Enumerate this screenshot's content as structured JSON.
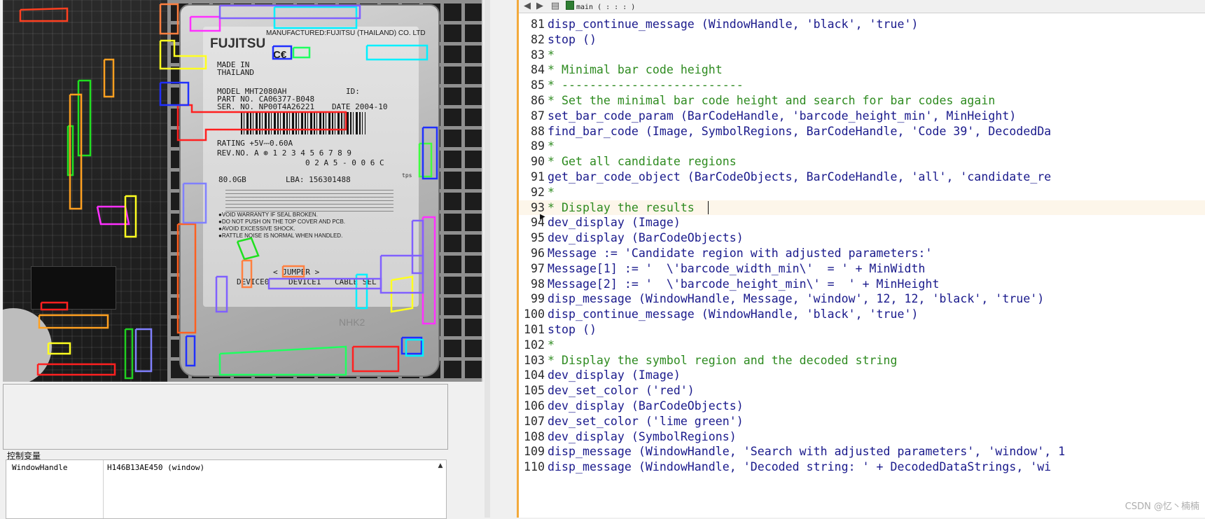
{
  "graphics_window": {
    "label_text": {
      "brand": "FUJITSU",
      "manufactured": "MANUFACTURED:FUJITSU (THAILAND) CO. LTD",
      "made_in": "MADE IN",
      "thailand": "THAILAND",
      "model": "MODEL   MHT2080AH",
      "id": "ID:",
      "part_no": "PART NO. CA06377-B048",
      "ser_no": "SER. NO. NP00T4A26221",
      "date": "DATE 2004-10",
      "rating": "RATING +5V⎓0.60A",
      "rev_no": "REV.NO. A ⊕ 1 2 3 4 5 6 7 8 9",
      "rev_no2": "0 2 A 5 - 0 0 6 C",
      "capacity": "80.0GB",
      "lba": "LBA: 156301488",
      "warn1": "●VOID WARRANTY IF SEAL BROKEN.",
      "warn2": "●DO NOT PUSH ON THE TOP COVER AND PCB.",
      "warn3": "●AVOID EXCESSIVE SHOCK.",
      "warn4": "●RATTLE NOISE IS NORMAL WHEN HANDLED.",
      "jumper": "< JUMPER >",
      "device0": "DEVICE0",
      "device1": "DEVICE1",
      "cable_sel": "CABLE SEL",
      "nhk2": "NHK2",
      "tps": "tps",
      "ce": "C€"
    },
    "overlay_colors": [
      "#ff2020",
      "#00e040",
      "#2040ff",
      "#00e0ff",
      "#ff20ff",
      "#ffff20",
      "#ff8040",
      "#8080ff",
      "#ffa020",
      "#ff4080"
    ]
  },
  "variables": {
    "title": "控制变量",
    "rows": [
      {
        "name": "WindowHandle",
        "value": "H146B13AE450 (window)"
      }
    ]
  },
  "toolbar": {
    "back_icon": "arrow-left-icon",
    "forward_icon": "arrow-right-icon",
    "procedure_label": "main ( : : : )"
  },
  "code_lines": [
    {
      "n": "81",
      "t": "disp_continue_message (WindowHandle, 'black', 'true')",
      "c": false
    },
    {
      "n": "82",
      "t": "stop ()",
      "c": false
    },
    {
      "n": "83",
      "t": "*",
      "c": true
    },
    {
      "n": "84",
      "t": "* Minimal bar code height",
      "c": true
    },
    {
      "n": "85",
      "t": "* --------------------------",
      "c": true
    },
    {
      "n": "86",
      "t": "* Set the minimal bar code height and search for bar codes again",
      "c": true
    },
    {
      "n": "87",
      "t": "set_bar_code_param (BarCodeHandle, 'barcode_height_min', MinHeight)",
      "c": false
    },
    {
      "n": "88",
      "t": "find_bar_code (Image, SymbolRegions, BarCodeHandle, 'Code 39', DecodedDa",
      "c": false
    },
    {
      "n": "89",
      "t": "*",
      "c": true
    },
    {
      "n": "90",
      "t": "* Get all candidate regions",
      "c": true
    },
    {
      "n": "91",
      "t": "get_bar_code_object (BarCodeObjects, BarCodeHandle, 'all', 'candidate_re",
      "c": false
    },
    {
      "n": "92",
      "t": "*",
      "c": true
    },
    {
      "n": "93",
      "t": "* Display the results",
      "c": true
    },
    {
      "n": "94",
      "t": "dev_display (Image)",
      "c": false
    },
    {
      "n": "95",
      "t": "dev_display (BarCodeObjects)",
      "c": false
    },
    {
      "n": "96",
      "t": "Message := 'Candidate region with adjusted parameters:'",
      "c": false
    },
    {
      "n": "97",
      "t": "Message[1] := '  \\'barcode_width_min\\'  = ' + MinWidth",
      "c": false
    },
    {
      "n": "98",
      "t": "Message[2] := '  \\'barcode_height_min\\' =  ' + MinHeight",
      "c": false
    },
    {
      "n": "99",
      "t": "disp_message (WindowHandle, Message, 'window', 12, 12, 'black', 'true')",
      "c": false
    },
    {
      "n": "100",
      "t": "disp_continue_message (WindowHandle, 'black', 'true')",
      "c": false
    },
    {
      "n": "101",
      "t": "stop ()",
      "c": false
    },
    {
      "n": "102",
      "t": "*",
      "c": true
    },
    {
      "n": "103",
      "t": "* Display the symbol region and the decoded string",
      "c": true
    },
    {
      "n": "104",
      "t": "dev_display (Image)",
      "c": false
    },
    {
      "n": "105",
      "t": "dev_set_color ('red')",
      "c": false
    },
    {
      "n": "106",
      "t": "dev_display (BarCodeObjects)",
      "c": false
    },
    {
      "n": "107",
      "t": "dev_set_color ('lime green')",
      "c": false
    },
    {
      "n": "108",
      "t": "dev_display (SymbolRegions)",
      "c": false
    },
    {
      "n": "109",
      "t": "disp_message (WindowHandle, 'Search with adjusted parameters', 'window', 1",
      "c": false
    },
    {
      "n": "110",
      "t": "disp_message (WindowHandle, 'Decoded string: ' + DecodedDataStrings, 'wi",
      "c": false
    }
  ],
  "current_line": "93",
  "watermark": "CSDN @忆丶楠楠"
}
